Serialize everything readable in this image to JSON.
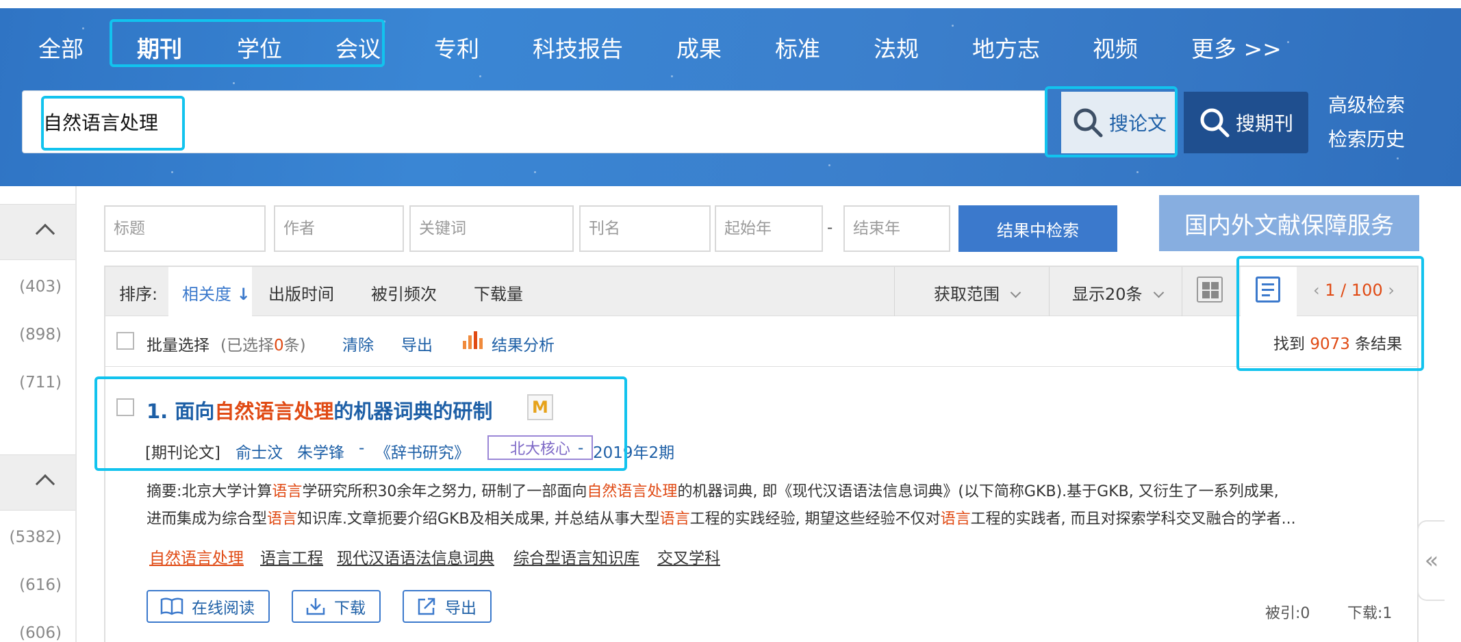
{
  "nav": {
    "items": [
      "全部",
      "期刊",
      "学位",
      "会议",
      "专利",
      "科技报告",
      "成果",
      "标准",
      "法规",
      "地方志",
      "视频",
      "更多 >>"
    ],
    "active": "期刊"
  },
  "search": {
    "value": "自然语言处理",
    "search_paper": "搜论文",
    "search_journal": "搜期刊",
    "advanced": "高级检索",
    "history": "检索历史"
  },
  "sidebar": {
    "counts_a": [
      "(403)",
      "(898)",
      "(711)"
    ],
    "counts_b": [
      "(5382)",
      "(616)",
      "(606)"
    ]
  },
  "filters": {
    "title_ph": "标题",
    "author_ph": "作者",
    "keyword_ph": "关键词",
    "journal_ph": "刊名",
    "start_ph": "起始年",
    "dash": "-",
    "end_ph": "结束年",
    "search_within": "结果中检索",
    "service": "国内外文献保障服务"
  },
  "sortbar": {
    "label": "排序:",
    "relevance": "相关度",
    "relevance_arrow": "↓",
    "pub_time": "出版时间",
    "cited": "被引频次",
    "downloads": "下载量",
    "scope": "获取范围",
    "per_page": "显示20条",
    "page_sep": "/",
    "page_current": "1",
    "page_total": "100"
  },
  "batch": {
    "select": "批量选择",
    "selected_prefix": "(已选择",
    "selected_count": "0",
    "selected_suffix": "条)",
    "clear": "清除",
    "export": "导出",
    "analysis": "结果分析",
    "found_prefix": "找到",
    "found_count": "9073",
    "found_suffix": "条结果"
  },
  "result": {
    "index": "1.",
    "title_pre": "面向",
    "title_hl": "自然语言处理",
    "title_post": "的机器词典的研制",
    "m_badge": "M",
    "type": "[期刊论文]",
    "author1": "俞士汶",
    "author2": "朱学锋",
    "sep1": "-",
    "journal": "《辞书研究》",
    "core": "北大核心",
    "sep2": "-",
    "issue": "2019年2期",
    "abstract_line1": [
      {
        "t": "摘要:北京大学计算",
        "hl": false
      },
      {
        "t": "语言",
        "hl": true
      },
      {
        "t": "学研究所积30余年之努力, 研制了一部面向",
        "hl": false
      },
      {
        "t": "自然语言处理",
        "hl": true
      },
      {
        "t": "的机器词典, 即《现代汉语语法信息词典》(以下简称GKB).基于GKB, 又衍生了一系列成果,",
        "hl": false
      }
    ],
    "abstract_line2": [
      {
        "t": "进而集成为综合型",
        "hl": false
      },
      {
        "t": "语言",
        "hl": true
      },
      {
        "t": "知识库.文章扼要介绍GKB及相关成果, 并总结从事大型",
        "hl": false
      },
      {
        "t": "语言",
        "hl": true
      },
      {
        "t": "工程的实践经验, 期望这些经验不仅对",
        "hl": false
      },
      {
        "t": "语言",
        "hl": true
      },
      {
        "t": "工程的实践者, 而且对探索学科交叉融合的学者...",
        "hl": false
      }
    ],
    "keywords": [
      "自然语言处理",
      "语言工程",
      "现代汉语语法信息词典",
      "综合型语言知识库",
      "交叉学科"
    ],
    "read_online": "在线阅读",
    "download": "下载",
    "export": "导出",
    "cited_label": "被引:",
    "cited_value": "0",
    "download_label": "下载:",
    "download_value": "1"
  },
  "collapse_glyph": "«",
  "colors": {
    "banner": "#3a86d4",
    "highlight_box": "#12c3ee",
    "link": "#1d5fa6",
    "accent_orange": "#e04a14",
    "button_blue": "#3b79cc",
    "core_badge": "#7d68c6"
  }
}
